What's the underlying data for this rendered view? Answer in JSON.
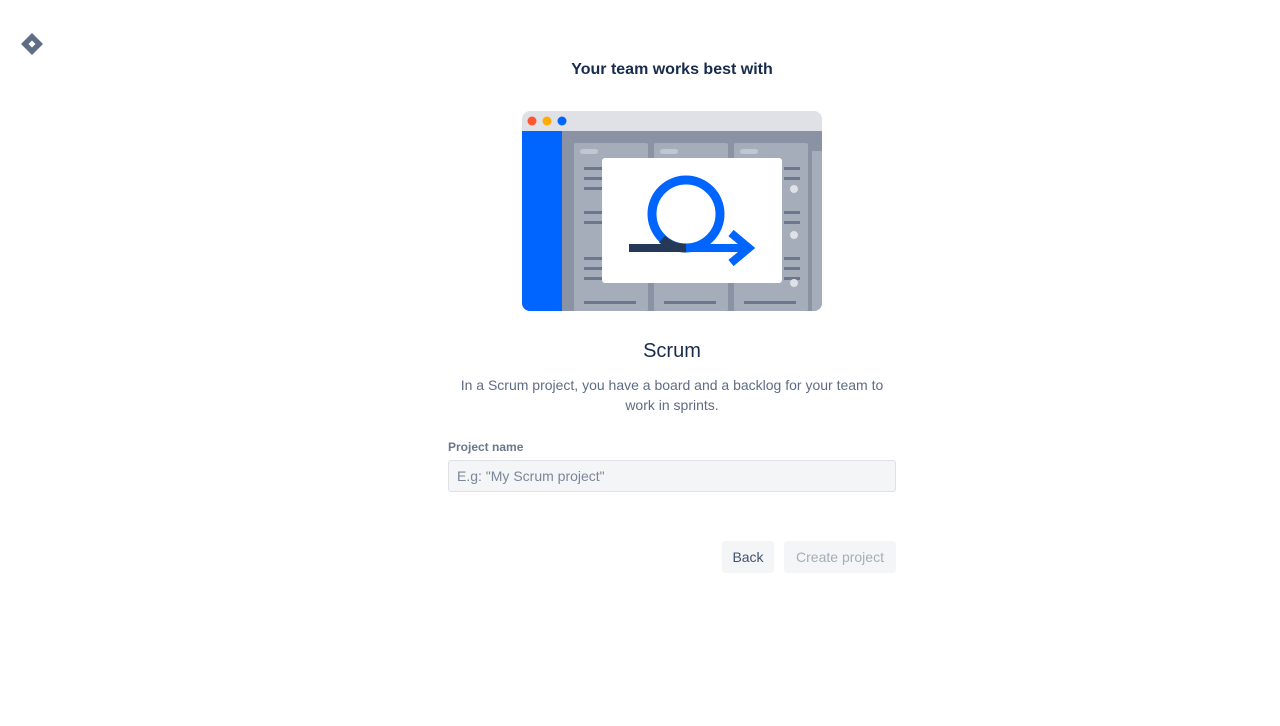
{
  "app": {
    "logo_icon": "jira-logo-icon"
  },
  "header": {
    "title": "Your team works best with"
  },
  "template": {
    "illustration_icon": "scrum-illustration",
    "name": "Scrum",
    "description": "In a Scrum project, you have a board and a backlog for your team to work in sprints."
  },
  "form": {
    "project_name_label": "Project name",
    "project_name_value": "",
    "project_name_placeholder": "E.g: \"My Scrum project\""
  },
  "actions": {
    "back_label": "Back",
    "create_label": "Create project",
    "create_disabled": true
  },
  "colors": {
    "brand_blue": "#0065ff",
    "text_primary": "#172b4d",
    "text_secondary": "#5e6c84",
    "logo": "#5e6c84"
  }
}
